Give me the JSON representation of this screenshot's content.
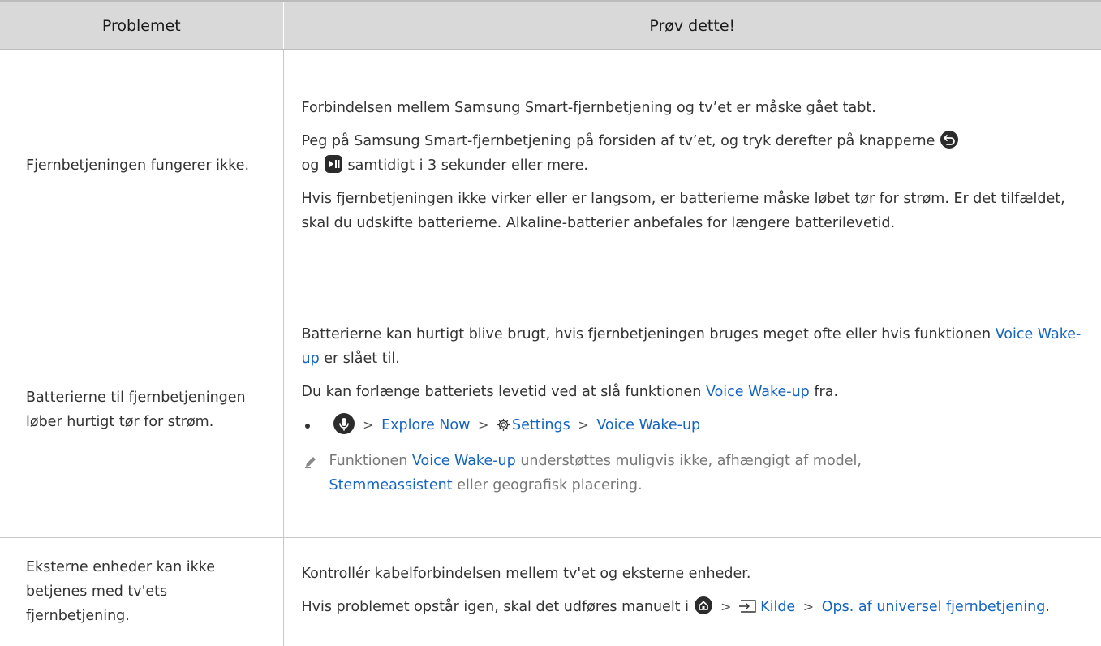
{
  "header": {
    "col1": "Problemet",
    "col2": "Prøv dette!"
  },
  "rows": [
    {
      "problem": "Fjernbetjeningen fungerer ikke.",
      "p1": "Forbindelsen mellem Samsung Smart-fjernbetjening og tv’et er måske gået tabt.",
      "p2a": "Peg på Samsung Smart-fjernbetjening på forsiden af tv’et, og tryk derefter på knapperne",
      "p2b": "og",
      "p2c": "samtidigt i 3 sekunder eller mere.",
      "p3": "Hvis fjernbetjeningen ikke virker eller er langsom, er batterierne måske løbet tør for strøm. Er det tilfældet, skal du udskifte batterierne. Alkaline-batterier anbefales for længere batterilevetid."
    },
    {
      "problem": "Batterierne til fjernbetjeningen løber hurtigt tør for strøm.",
      "p1a": "Batterierne kan hurtigt blive brugt, hvis fjernbetjeningen bruges meget ofte eller hvis funktionen",
      "p1_link": "Voice Wake-up",
      "p1b": "er slået til.",
      "p2a": "Du kan forlænge batteriets levetid ved at slå funktionen",
      "p2_link": "Voice Wake-up",
      "p2b": "fra.",
      "path": [
        "Explore Now",
        "Settings",
        "Voice Wake-up"
      ],
      "note_a": "Funktionen",
      "note_link1": "Voice Wake-up",
      "note_b": "understøttes muligvis ikke, afhængigt af model,",
      "note_link2": "Stemmeassistent",
      "note_c": "eller geografisk placering."
    },
    {
      "problem": "Eksterne enheder kan ikke betjenes med tv'ets fjernbetjening.",
      "p1": "Kontrollér kabelforbindelsen mellem tv'et og eksterne enheder.",
      "p2a": "Hvis problemet opstår igen, skal det udføres manuelt i",
      "path1": "Kilde",
      "path2": "Ops. af universel fjernbetjening",
      "p2b": "."
    }
  ],
  "separator": ">",
  "colors": {
    "link": "#1565c0",
    "header_bg": "#d9d9d9",
    "text": "#333333",
    "note": "#777777"
  }
}
